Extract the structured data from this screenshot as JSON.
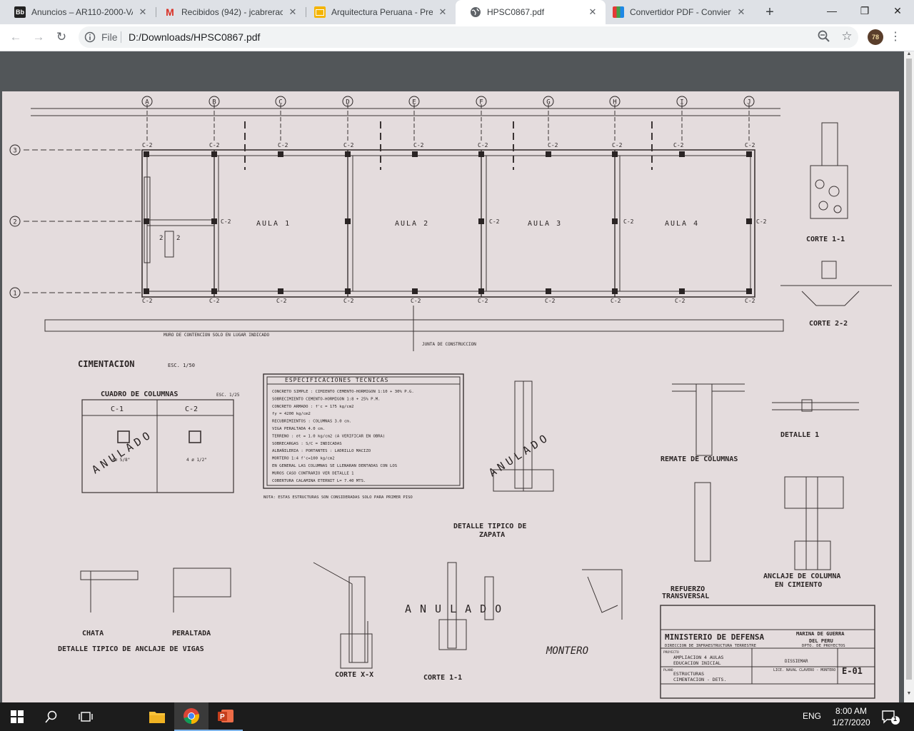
{
  "browser": {
    "tabs": [
      {
        "title": "Anuncios – AR110-2000-VA",
        "favicon": "bb-icon",
        "active": false
      },
      {
        "title": "Recibidos (942) - jcabreracu",
        "favicon": "gmail-icon",
        "active": false
      },
      {
        "title": "Arquitectura Peruana - Pres",
        "favicon": "slides-icon",
        "active": false
      },
      {
        "title": "HPSC0867.pdf",
        "favicon": "globe-icon",
        "active": true
      },
      {
        "title": "Convertidor PDF - Convierte",
        "favicon": "pdf-converter-icon",
        "active": false
      }
    ],
    "address": {
      "scheme": "File",
      "url": "D:/Downloads/HPSC0867.pdf"
    },
    "avatar_text": "78",
    "favicon_text": {
      "bb": "Bb",
      "gmail": "M"
    }
  },
  "drawing": {
    "columns": [
      "A",
      "B",
      "C",
      "D",
      "E",
      "F",
      "G",
      "H",
      "I",
      "J"
    ],
    "rows": [
      "3",
      "2",
      "1"
    ],
    "rooms": [
      "AULA 1",
      "AULA 2",
      "AULA 3",
      "AULA 4"
    ],
    "col_label": "C-2",
    "toilet_label": "2",
    "main_title": "CIMENTACION",
    "main_title_scale": "ESC. 1/50",
    "col_table": {
      "title": "CUADRO DE COLUMNAS",
      "scale": "ESC. 1/25",
      "headers": [
        "C-1",
        "C-2"
      ],
      "c1_text": "4ø 5/8\"",
      "c2_text": "4 ø 1/2\""
    },
    "specs": {
      "title": "ESPECIFICACIONES TECNICAS",
      "lines": [
        "CONCRETO SIMPLE : CIMIENTO CEMENTO-HORMIGON 1:10 + 30% P.G.",
        "SOBRECIMIENTO CEMENTO-HORMIGON 1:8 + 25% P.M.",
        "CONCRETO ARMADO : f'c = 175 kg/cm2",
        "fy = 4200 kg/cm2",
        "RECUBRIMIENTOS : COLUMNAS 3.0 cm.",
        "VIGA PERALTADA 4.0 cm.",
        "TERRENO : σt = 1.0 kg/cm2 (A VERIFICAR EN OBRA)",
        "SOBRECARGAS : S/C = INDICADAS",
        "ALBAÑILERIA : PORTANTES : LADRILLO MACIZO",
        "MORTERO 1:4 f'c=100 kg/cm2",
        "EN GENERAL LAS COLUMNAS SE LLENARAN DENTADAS CON LOS",
        "MUROS CASO CONTRARIO VER DETALLE 1",
        "COBERTURA CALAMINA ETERNIT L= 7.40 MTS."
      ],
      "note": "NOTA: ESTAS ESTRUCTURAS SON CONSIDERADAS SOLO PARA PRIMER PISO"
    },
    "anulado": "ANULADO",
    "details": {
      "corte11_top": "CORTE 1-1",
      "corte22": "CORTE 2-2",
      "detalle_zapata_1": "DETALLE TIPICO DE",
      "detalle_zapata_2": "ZAPATA",
      "remate": "REMATE DE COLUMNAS",
      "detalle1": "DETALLE 1",
      "refuerzo_1": "REFUERZO",
      "refuerzo_2": "TRANSVERSAL",
      "anclaje_col_1": "ANCLAJE DE COLUMNA",
      "anclaje_col_2": "EN CIMIENTO",
      "chata": "CHATA",
      "peraltada": "PERALTADA",
      "anclaje_vigas": "DETALLE TIPICO DE ANCLAJE DE VIGAS",
      "corte_xx": "CORTE X-X",
      "corte11_bottom": "CORTE 1-1",
      "montero": "MONTERO",
      "junta": "JUNTA DE CONSTRUCCION",
      "muro_contencion": "MURO DE CONTENCION SOLO EN LUGAR INDICADO"
    },
    "title_block": {
      "org": "MINISTERIO DE DEFENSA",
      "sub_org_1": "MARINA DE GUERRA",
      "sub_org_2": "DEL PERU",
      "dept": "DIRECCION DE INFRAESTRUCTURA TERRESTRE",
      "dept2": "DPTO. DE PROYECTOS",
      "project_label": "PROYECTO",
      "project_1": "AMPLIACION 4 AULAS",
      "project_2": "EDUCACION INICIAL",
      "plano_label": "PLANO",
      "plano_1": "ESTRUCTURAS",
      "plano_2": "CIMENTACION - DETS.",
      "dependencia": "DISSIEMAR",
      "ubicacion": "LICE. NAVAL CLAVERO - MONTERO",
      "sheet": "E-01"
    }
  },
  "taskbar": {
    "language": "ENG",
    "time": "8:00 AM",
    "date": "1/27/2020",
    "notifications": "1"
  }
}
